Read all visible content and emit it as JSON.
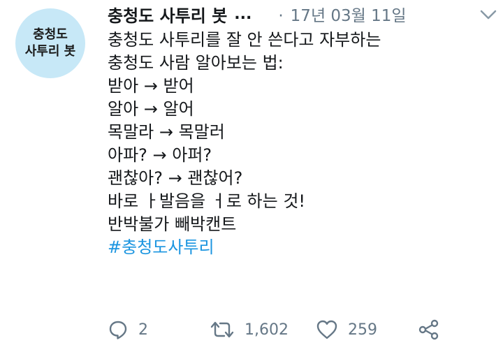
{
  "author": {
    "avatar_lines": [
      "충청도",
      "사투리 봇"
    ],
    "display_name": "충청도 사투리 봇",
    "ellipsis": "...",
    "date": "17년 03월 11일",
    "date_separator": "·"
  },
  "tweet": {
    "lines": [
      "충청도 사투리를 잘 안 쓴다고 자부하는",
      "충청도 사람 알아보는 법:",
      "받아 → 받어",
      "알아 → 알어",
      "목말라 → 목말러",
      "아파? → 아퍼?",
      "괜찮아? → 괜찮어?",
      "바로 ㅏ발음을 ㅓ로 하는 것!",
      "반박불가 빼박캔트"
    ],
    "hashtag": "#충청도사투리"
  },
  "actions": {
    "reply_count": "2",
    "retweet_count": "1,602",
    "like_count": "259"
  },
  "icons": {
    "avatar_bg": "#c7e8f7",
    "action_color": "#657786",
    "hashtag_color": "#1b95e0"
  }
}
